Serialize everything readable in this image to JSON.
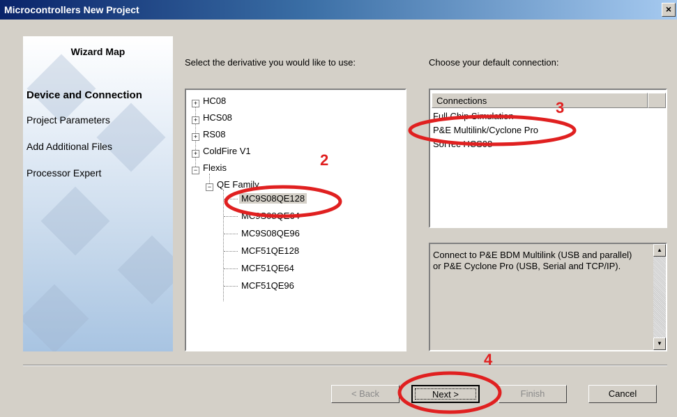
{
  "window": {
    "title": "Microcontrollers New Project",
    "close_label": "×"
  },
  "wizard_map": {
    "title": "Wizard Map",
    "steps": [
      {
        "label": "Device and Connection",
        "active": true
      },
      {
        "label": "Project Parameters",
        "active": false
      },
      {
        "label": "Add Additional Files",
        "active": false
      },
      {
        "label": "Processor Expert",
        "active": false
      }
    ]
  },
  "derivative": {
    "prompt": "Select the derivative you would like to use:",
    "tree": [
      {
        "label": "HC08",
        "toggle": "+"
      },
      {
        "label": "HCS08",
        "toggle": "+"
      },
      {
        "label": "RS08",
        "toggle": "+"
      },
      {
        "label": "ColdFire V1",
        "toggle": "+"
      },
      {
        "label": "Flexis",
        "toggle": "−"
      },
      {
        "label": "QE Family",
        "toggle": "−"
      },
      {
        "label": "MC9S08QE128",
        "selected": true
      },
      {
        "label": "MC9S08QE64"
      },
      {
        "label": "MC9S08QE96"
      },
      {
        "label": "MCF51QE128"
      },
      {
        "label": "MCF51QE64"
      },
      {
        "label": "MCF51QE96"
      }
    ]
  },
  "connection": {
    "prompt": "Choose your default connection:",
    "column_header": "Connections",
    "items": [
      "Full Chip Simulation",
      "P&E Multilink/Cyclone Pro",
      "SofTec HCS08"
    ],
    "description": "Connect to P&E BDM Multilink (USB and parallel) or P&E Cyclone Pro (USB, Serial and TCP/IP)."
  },
  "buttons": {
    "back": "< Back",
    "next": "Next >",
    "finish": "Finish",
    "cancel": "Cancel"
  },
  "annotations": {
    "color": "#e02020",
    "labels": [
      "2",
      "3",
      "4"
    ]
  }
}
